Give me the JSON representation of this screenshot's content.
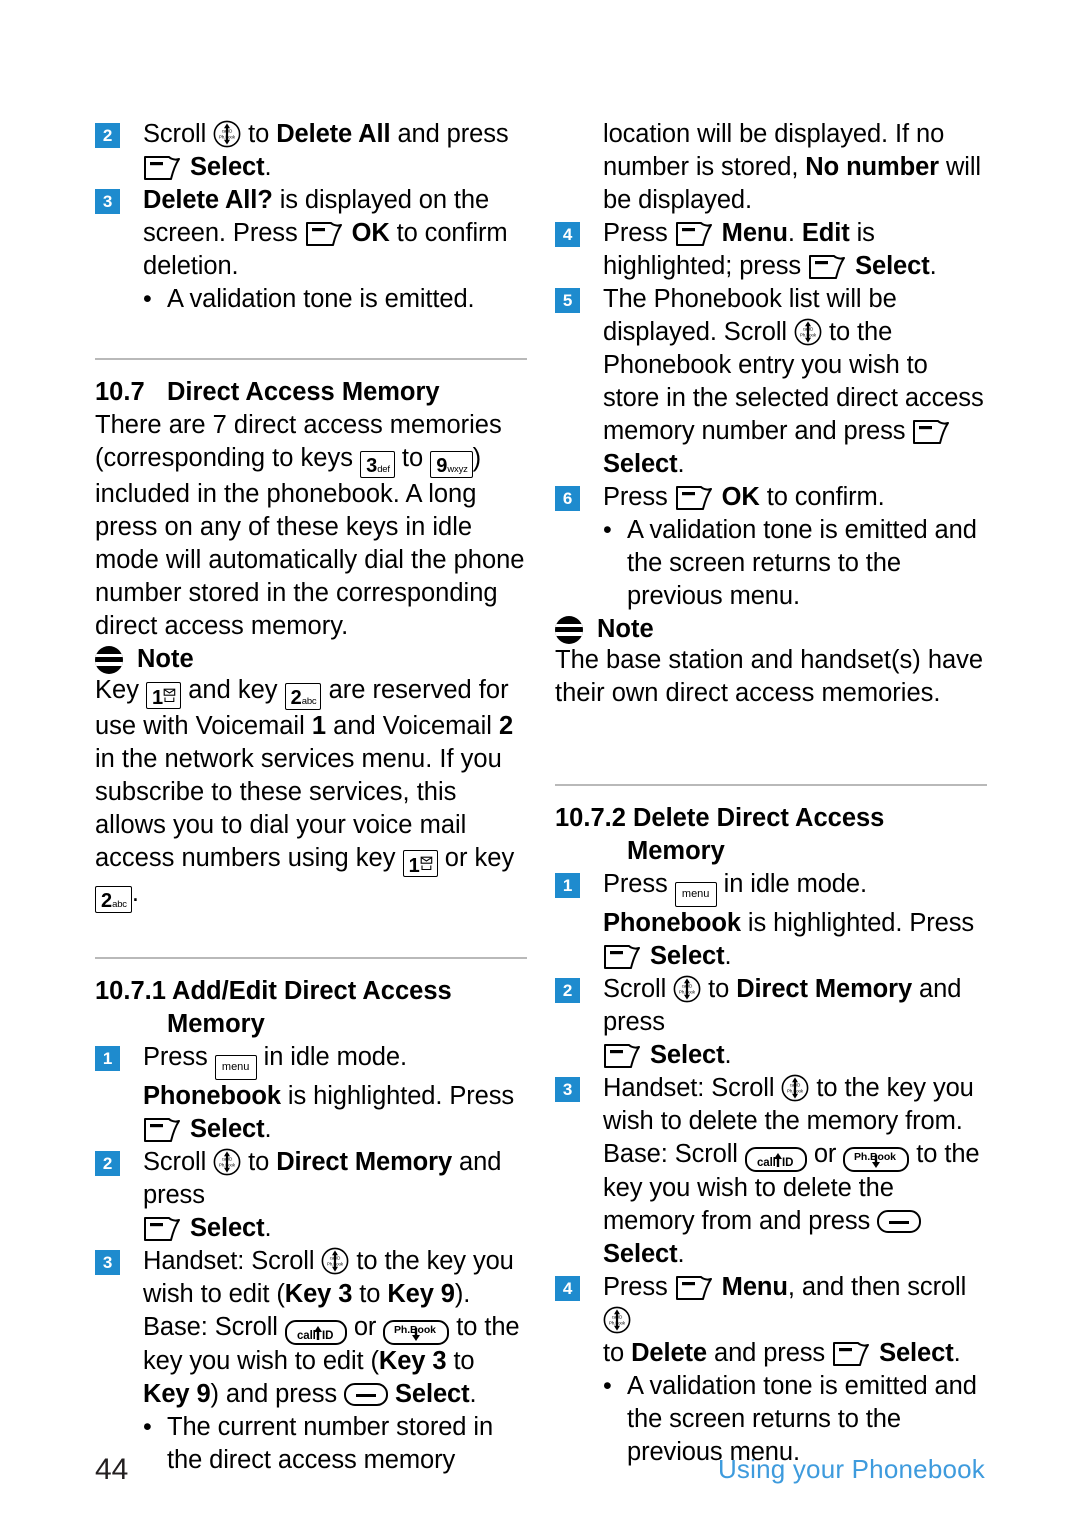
{
  "meta": {
    "accent_blue": "#1e8bce",
    "footer_blue": "#3e9bdd",
    "rule_gray": "#b9b9b9"
  },
  "icons": {
    "scroll": "scroll-navigation-key-icon",
    "softkey": "left-soft-key-icon",
    "menu_label": "menu",
    "callid_label": "callID",
    "phbook_label": "Ph.Book",
    "base_select": "base-select-key-icon",
    "note": "note-icon"
  },
  "left_column": {
    "step2": {
      "num": "2",
      "t1": "Scroll ",
      "t2": " to ",
      "b1": "Delete All",
      "t3": " and press",
      "t4": " ",
      "b2": "Select",
      "t5": "."
    },
    "step3": {
      "num": "3",
      "b1": "Delete All?",
      "t1": " is displayed on the screen. Press ",
      "b2": "OK",
      "t2": " to confirm deletion."
    },
    "bullet1": {
      "dot": "•",
      "text": "A validation tone is emitted."
    },
    "section": {
      "number": "10.7",
      "title": "Direct Access Memory"
    },
    "intro": {
      "p1": "There are 7 direct access memories (corresponding to keys ",
      "key_from_digit": "3",
      "key_from_letters": "def",
      "p2": " to ",
      "key_to_digit": "9",
      "key_to_letters": "wxyz",
      "p3": ") included in the phonebook. A long press on any of these keys in idle mode will automatically dial the phone number stored in the corresponding direct access memory."
    },
    "note": {
      "title": "Note",
      "p1": "Key ",
      "key1_digit": "1",
      "p2": " and key ",
      "key2_digit": "2",
      "key2_letters": "abc",
      "p3": " are reserved for use with Voicemail ",
      "b1": "1",
      "p4": " and Voicemail ",
      "b2": "2",
      "p5": " in the network services menu. If you subscribe to these services, this allows you to dial your voice mail access numbers using key ",
      "p6": " or key ",
      "p7": "."
    },
    "subsection": {
      "number": "10.7.1",
      "title_line1": "Add/Edit Direct Access",
      "title_line2": "Memory"
    },
    "s1": {
      "num": "1",
      "t1": "Press ",
      "t2": " in idle mode.",
      "b1": "Phonebook",
      "t3": " is highlighted. Press",
      "b2": "Select",
      "t4": "."
    },
    "s2": {
      "num": "2",
      "t1": "Scroll ",
      "t2": " to ",
      "b1": "Direct Memory",
      "t3": " and press ",
      "b2": "Select",
      "t4": "."
    },
    "s3": {
      "num": "3",
      "t1": "Handset: Scroll ",
      "t2": " to the key you wish to edit (",
      "b1": "Key 3",
      "t3": " to ",
      "b2": "Key 9",
      "t4": ").",
      "t5": "Base: Scroll ",
      "t6": " or ",
      "t7": " to the key you wish to edit (",
      "b3": "Key 3",
      "t8": " to ",
      "b4": "Key 9",
      "t9": ") and press ",
      "b5": "Select",
      "t10": "."
    },
    "bullet2": {
      "dot": "•",
      "text": "The current number stored in the direct access memory"
    }
  },
  "right_column": {
    "cont": {
      "t1": "location will be displayed. If no number is stored, ",
      "b1": "No number",
      "t2": " will be displayed."
    },
    "s4": {
      "num": "4",
      "t1": "Press ",
      "b1": "Menu",
      "t2": ". ",
      "b2": "Edit",
      "t3": " is highlighted; press ",
      "b3": "Select",
      "t4": "."
    },
    "s5": {
      "num": "5",
      "t1": "The Phonebook list will be displayed. Scroll ",
      "t2": " to the Phonebook entry you wish to store in the selected direct access memory number and press ",
      "b1": "Select",
      "t3": "."
    },
    "s6": {
      "num": "6",
      "t1": "Press ",
      "b1": "OK",
      "t2": " to confirm."
    },
    "bullet1": {
      "dot": "•",
      "text": "A validation tone is emitted and the screen returns to the previous menu."
    },
    "note": {
      "title": "Note",
      "text": "The base station and handset(s) have their own direct access memories."
    },
    "subsection": {
      "number": "10.7.2",
      "title_line1": "Delete Direct Access",
      "title_line2": "Memory"
    },
    "d1": {
      "num": "1",
      "t1": "Press ",
      "t2": " in idle mode.",
      "b1": "Phonebook",
      "t3": " is highlighted. Press",
      "b2": "Select",
      "t4": "."
    },
    "d2": {
      "num": "2",
      "t1": "Scroll ",
      "t2": " to ",
      "b1": "Direct Memory",
      "t3": " and press ",
      "b2": "Select",
      "t4": "."
    },
    "d3": {
      "num": "3",
      "t1": "Handset: Scroll ",
      "t2": " to the key you wish to delete the memory from.",
      "t3": "Base: Scroll ",
      "t4": " or ",
      "t5": " to the key you wish to delete the memory from and press ",
      "b1": "Select",
      "t6": "."
    },
    "d4": {
      "num": "4",
      "t1": "Press ",
      "b1": "Menu",
      "t2": ", and then scroll ",
      "t3": "to ",
      "b2": "Delete",
      "t4": " and press ",
      "b3": "Select",
      "t5": "."
    },
    "bullet2": {
      "dot": "•",
      "text": "A validation tone is emitted and the screen returns to the previous menu."
    }
  },
  "footer": {
    "page_number": "44",
    "chapter": "Using your Phonebook"
  }
}
